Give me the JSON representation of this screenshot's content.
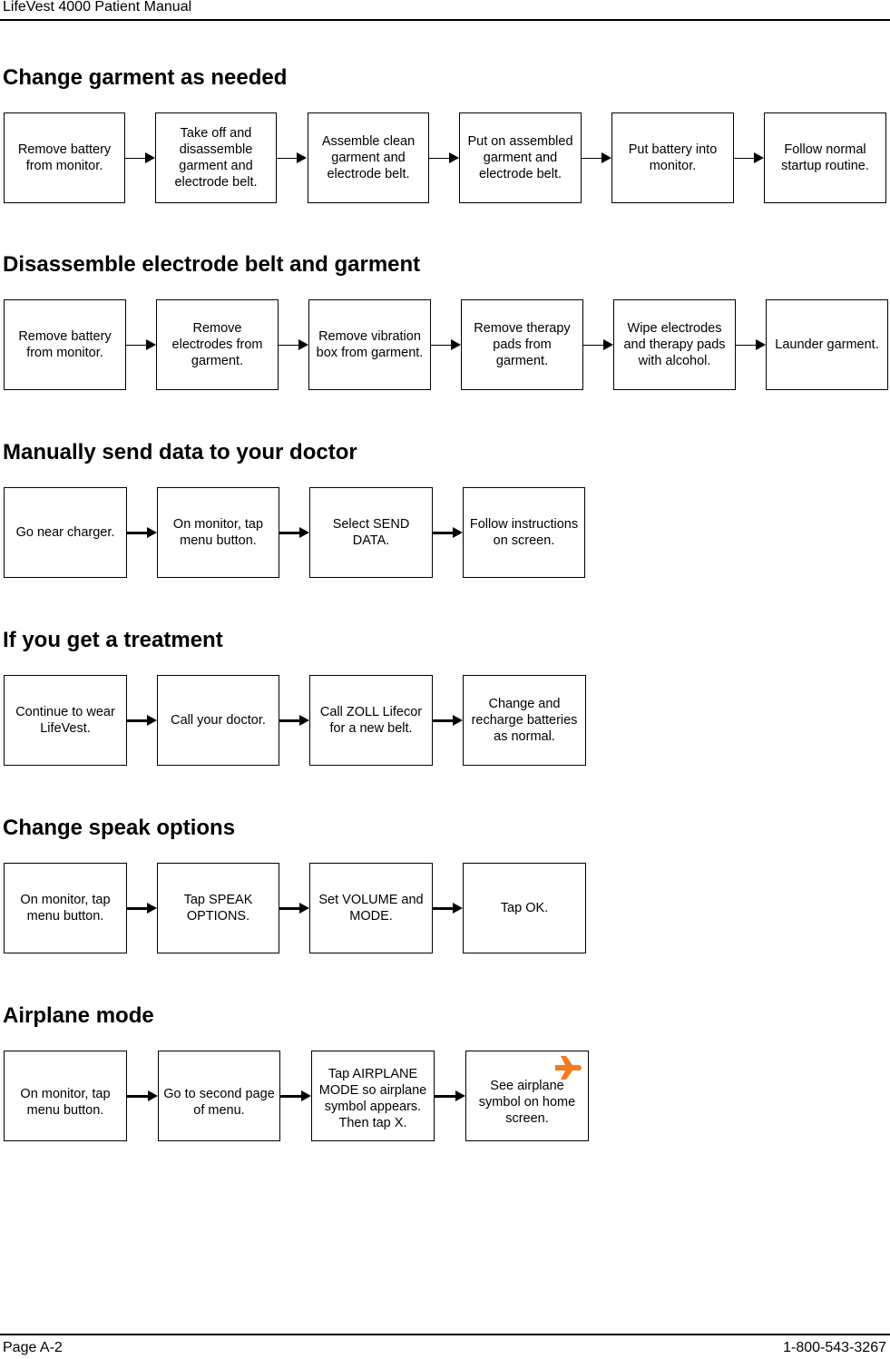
{
  "header": {
    "title": "LifeVest 4000 Patient Manual"
  },
  "footer": {
    "page": "Page A-2",
    "phone": "1-800-543-3267"
  },
  "sections": [
    {
      "title": "Change garment as needed",
      "steps": [
        "Remove battery\nfrom monitor.",
        "Take off and\ndisassemble\ngarment and\nelectrode belt.",
        "Assemble clean\ngarment and\nelectrode belt.",
        "Put on assembled\ngarment and\nelectrode belt.",
        "Put battery into\nmonitor.",
        "Follow normal\nstartup routine."
      ]
    },
    {
      "title": "Disassemble electrode belt and garment",
      "steps": [
        "Remove battery\nfrom monitor.",
        "Remove\nelectrodes from\ngarment.",
        "Remove vibration\nbox from garment.",
        "Remove therapy\npads from\ngarment.",
        "Wipe electrodes\nand therapy pads\nwith alcohol.",
        "Launder garment."
      ]
    },
    {
      "title": "Manually send data to your doctor",
      "steps": [
        "Go near charger.",
        "On monitor, tap\nmenu button.",
        "Select SEND\nDATA.",
        "Follow instructions\non screen."
      ]
    },
    {
      "title": "If you get a treatment",
      "steps": [
        "Continue to wear\nLifeVest.",
        "Call your doctor.",
        "Call ZOLL Lifecor\nfor a new belt.",
        "Change and\nrecharge batteries\nas normal."
      ]
    },
    {
      "title": "Change speak options",
      "steps": [
        "On monitor, tap\nmenu button.",
        "Tap SPEAK\nOPTIONS.",
        "Set VOLUME and\nMODE.",
        "Tap OK."
      ]
    },
    {
      "title": "Airplane mode",
      "steps": [
        "On monitor, tap\nmenu button.",
        "Go to second page\nof menu.",
        "Tap AIRPLANE\nMODE so airplane\nsymbol appears.\nThen tap X.",
        "See airplane\nsymbol on home\nscreen."
      ],
      "icon": "airplane-icon",
      "icon_color": "#F47B20"
    }
  ]
}
